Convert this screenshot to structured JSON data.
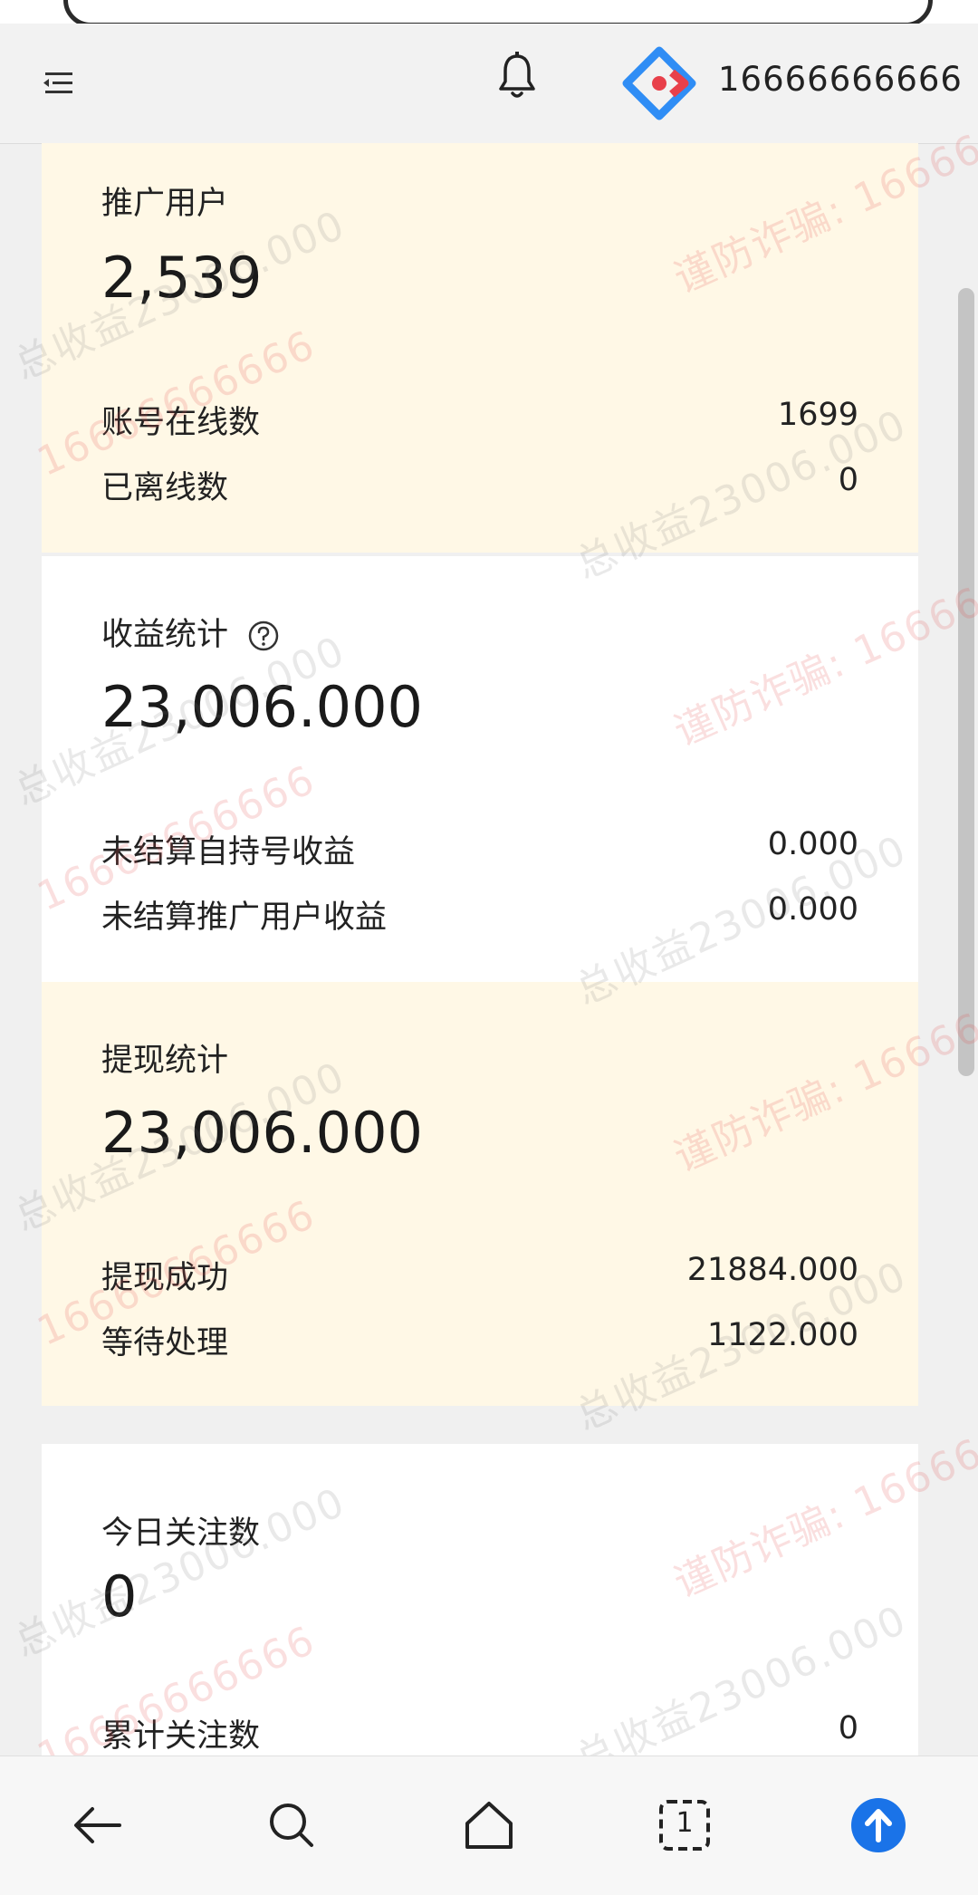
{
  "header": {
    "username": "16666666666"
  },
  "cards": {
    "promo": {
      "title": "推广用户",
      "big_value": "2,539",
      "rows": [
        {
          "label": "账号在线数",
          "value": "1699"
        },
        {
          "label": "已离线数",
          "value": "0"
        }
      ]
    },
    "income": {
      "title": "收益统计",
      "big_value": "23,006.000",
      "rows": [
        {
          "label": "未结算自持号收益",
          "value": "0.000"
        },
        {
          "label": "未结算推广用户收益",
          "value": "0.000"
        }
      ]
    },
    "withdraw": {
      "title": "提现统计",
      "big_value": "23,006.000",
      "rows": [
        {
          "label": "提现成功",
          "value": "21884.000"
        },
        {
          "label": "等待处理",
          "value": "1122.000"
        }
      ]
    },
    "follow": {
      "title": "今日关注数",
      "big_value": "0",
      "rows": [
        {
          "label": "累计关注数",
          "value": "0"
        }
      ]
    }
  },
  "watermark": {
    "text_a": "谨防诈骗: 16666",
    "text_b": "总收益23006.000",
    "text_c": "总收益23006.000",
    "text_d": "16666666666"
  },
  "bottom_bar": {
    "tab_count": "1"
  },
  "colors": {
    "accent": "#1a73e8",
    "card_yellow": "#fff8e6",
    "logo_blue": "#2f8df5",
    "logo_red": "#e8404a"
  },
  "icons": [
    "menu-icon",
    "bell-icon",
    "logo-icon",
    "help-icon",
    "back-icon",
    "search-icon",
    "home-icon",
    "tabs-icon",
    "upload-icon"
  ]
}
